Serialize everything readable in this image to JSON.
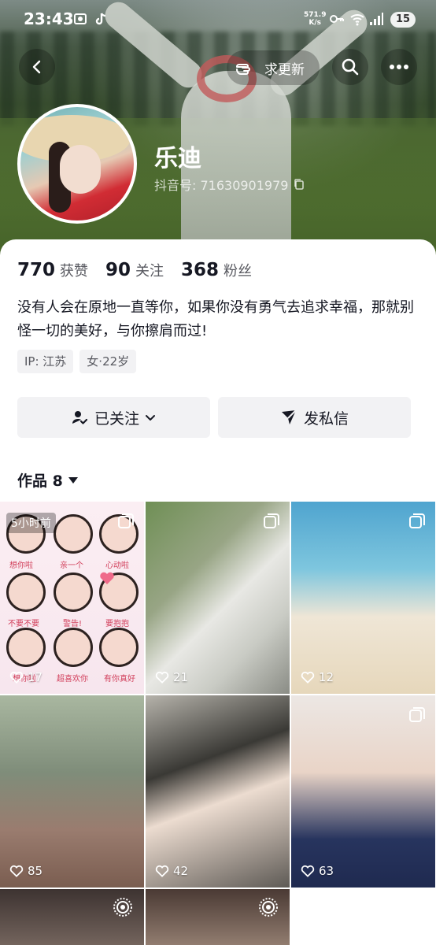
{
  "status_bar": {
    "time": "23:43",
    "net_speed_value": "571.9",
    "net_speed_unit": "K/s",
    "battery": "15"
  },
  "top_nav": {
    "update_label": "求更新"
  },
  "profile": {
    "nickname": "乐迪",
    "douyin_id": "抖音号: 71630901979",
    "stats": [
      {
        "value": "770",
        "label": "获赞"
      },
      {
        "value": "90",
        "label": "关注"
      },
      {
        "value": "368",
        "label": "粉丝"
      }
    ],
    "bio": "没有人会在原地一直等你，如果你没有勇气去追求幸福，那就别怪一切的美好，与你擦肩而过!",
    "tags": [
      "IP: 江苏",
      "女·22岁"
    ]
  },
  "actions": {
    "follow_label": "已关注",
    "message_label": "发私信"
  },
  "works": {
    "tab_label": "作品 8",
    "items": [
      {
        "likes": "17",
        "time_badge": "5小时前",
        "sticker_labels": [
          "想你啦",
          "亲一个",
          "心动啦",
          "不要不要",
          "警告!",
          "要抱抱",
          "想你啦",
          "超喜欢你",
          "有你真好"
        ]
      },
      {
        "likes": "21"
      },
      {
        "likes": "12"
      },
      {
        "likes": "85"
      },
      {
        "likes": "42"
      },
      {
        "likes": "63"
      }
    ]
  }
}
